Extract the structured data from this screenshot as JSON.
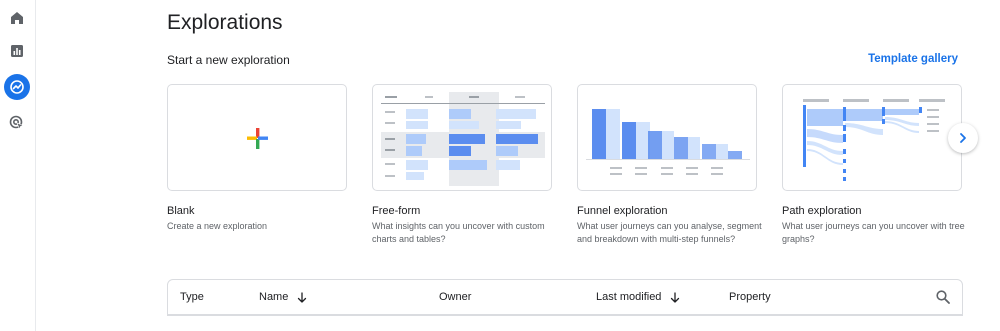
{
  "nav": {
    "items": [
      {
        "name": "home",
        "icon": "home-icon"
      },
      {
        "name": "reports",
        "icon": "bar-chart-icon"
      },
      {
        "name": "explore",
        "icon": "explore-icon",
        "active": true
      },
      {
        "name": "advertising",
        "icon": "target-cursor-icon"
      }
    ]
  },
  "page": {
    "title": "Explorations",
    "subtitle": "Start a new exploration",
    "template_gallery": "Template gallery"
  },
  "templates": [
    {
      "title": "Blank",
      "description": "Create a new exploration"
    },
    {
      "title": "Free-form",
      "description": "What insights can you uncover with custom charts and tables?"
    },
    {
      "title": "Funnel exploration",
      "description": "What user journeys can you analyse, segment and breakdown with multi-step funnels?"
    },
    {
      "title": "Path exploration",
      "description": "What user journeys can you uncover with tree graphs?"
    }
  ],
  "table": {
    "columns": {
      "type": "Type",
      "name": "Name",
      "owner": "Owner",
      "last_modified": "Last modified",
      "property": "Property"
    }
  },
  "colors": {
    "accent": "#1a73e8",
    "plus_red": "#ea4335",
    "plus_yellow": "#fbbc04",
    "plus_green": "#34a853",
    "plus_blue": "#4285f4"
  }
}
